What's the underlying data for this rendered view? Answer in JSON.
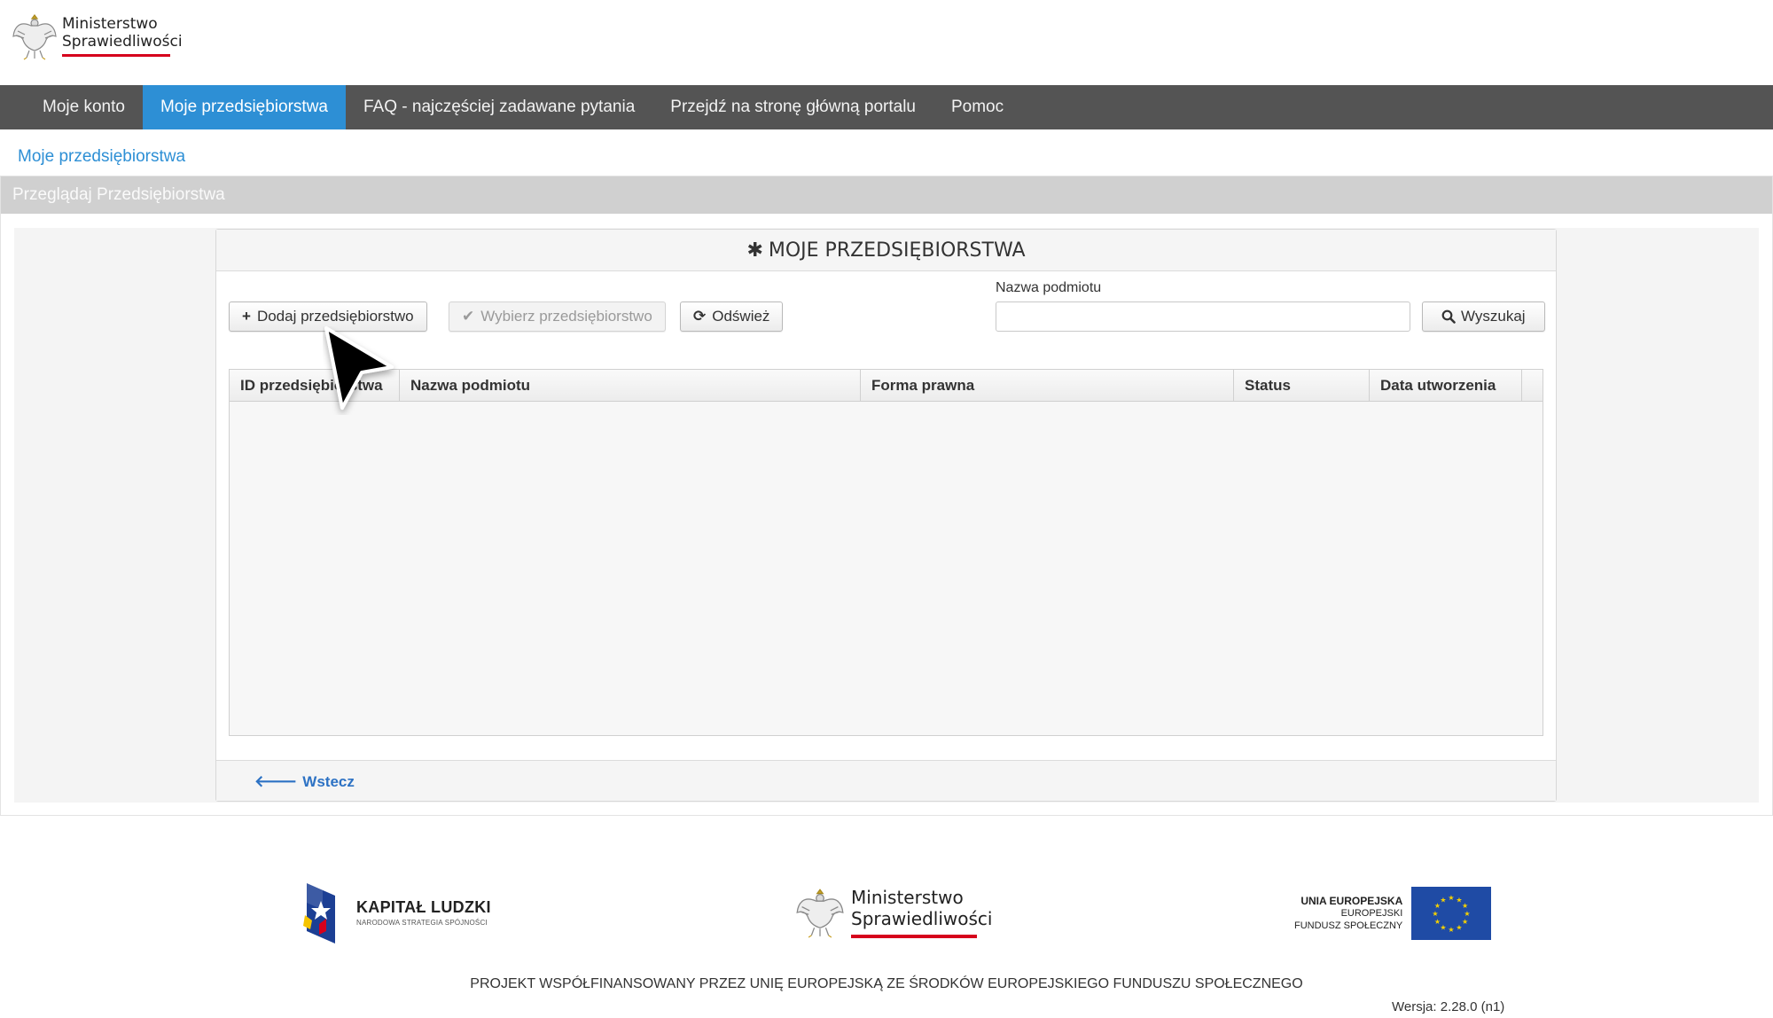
{
  "header": {
    "logo_line1": "Ministerstwo",
    "logo_line2": "Sprawiedliwości"
  },
  "nav": {
    "items": [
      {
        "label": "Moje konto",
        "active": false
      },
      {
        "label": "Moje przedsiębiorstwa",
        "active": true
      },
      {
        "label": "FAQ - najczęściej zadawane pytania",
        "active": false
      },
      {
        "label": "Przejdź na stronę główną portalu",
        "active": false
      },
      {
        "label": "Pomoc",
        "active": false
      }
    ]
  },
  "breadcrumb": "Moje przedsiębiorstwa",
  "panel": {
    "heading": "Przeglądaj Przedsiębiorstwa"
  },
  "inner": {
    "title": "MOJE PRZEDSIĘBIORSTWA",
    "add_button": "Dodaj przedsiębiorstwo",
    "select_button": "Wybierz przedsiębiorstwo",
    "refresh_button": "Odśwież",
    "search_label": "Nazwa podmiotu",
    "search_value": "",
    "search_button": "Wyszukaj",
    "back_link": "Wstecz"
  },
  "table": {
    "columns": [
      "ID przedsiębiorstwa",
      "Nazwa podmiotu",
      "Forma prawna",
      "Status",
      "Data utworzenia"
    ],
    "rows": []
  },
  "footer": {
    "kl_title": "KAPITAŁ LUDZKI",
    "kl_subtitle": "NARODOWA STRATEGIA SPÓJNOŚCI",
    "ms_line1": "Ministerstwo",
    "ms_line2": "Sprawiedliwości",
    "eu_line1": "UNIA EUROPEJSKA",
    "eu_line2": "EUROPEJSKI",
    "eu_line3": "FUNDUSZ SPOŁECZNY",
    "project_text": "PROJEKT WSPÓŁFINANSOWANY PRZEZ UNIĘ EUROPEJSKĄ ZE ŚRODKÓW EUROPEJSKIEGO FUNDUSZU SPOŁECZNEGO",
    "version": "Wersja: 2.28.0 (n1)"
  },
  "colors": {
    "nav_bg": "#545454",
    "nav_active": "#2d8fd5",
    "link": "#2d8fd5",
    "brand_red": "#d6001c"
  }
}
